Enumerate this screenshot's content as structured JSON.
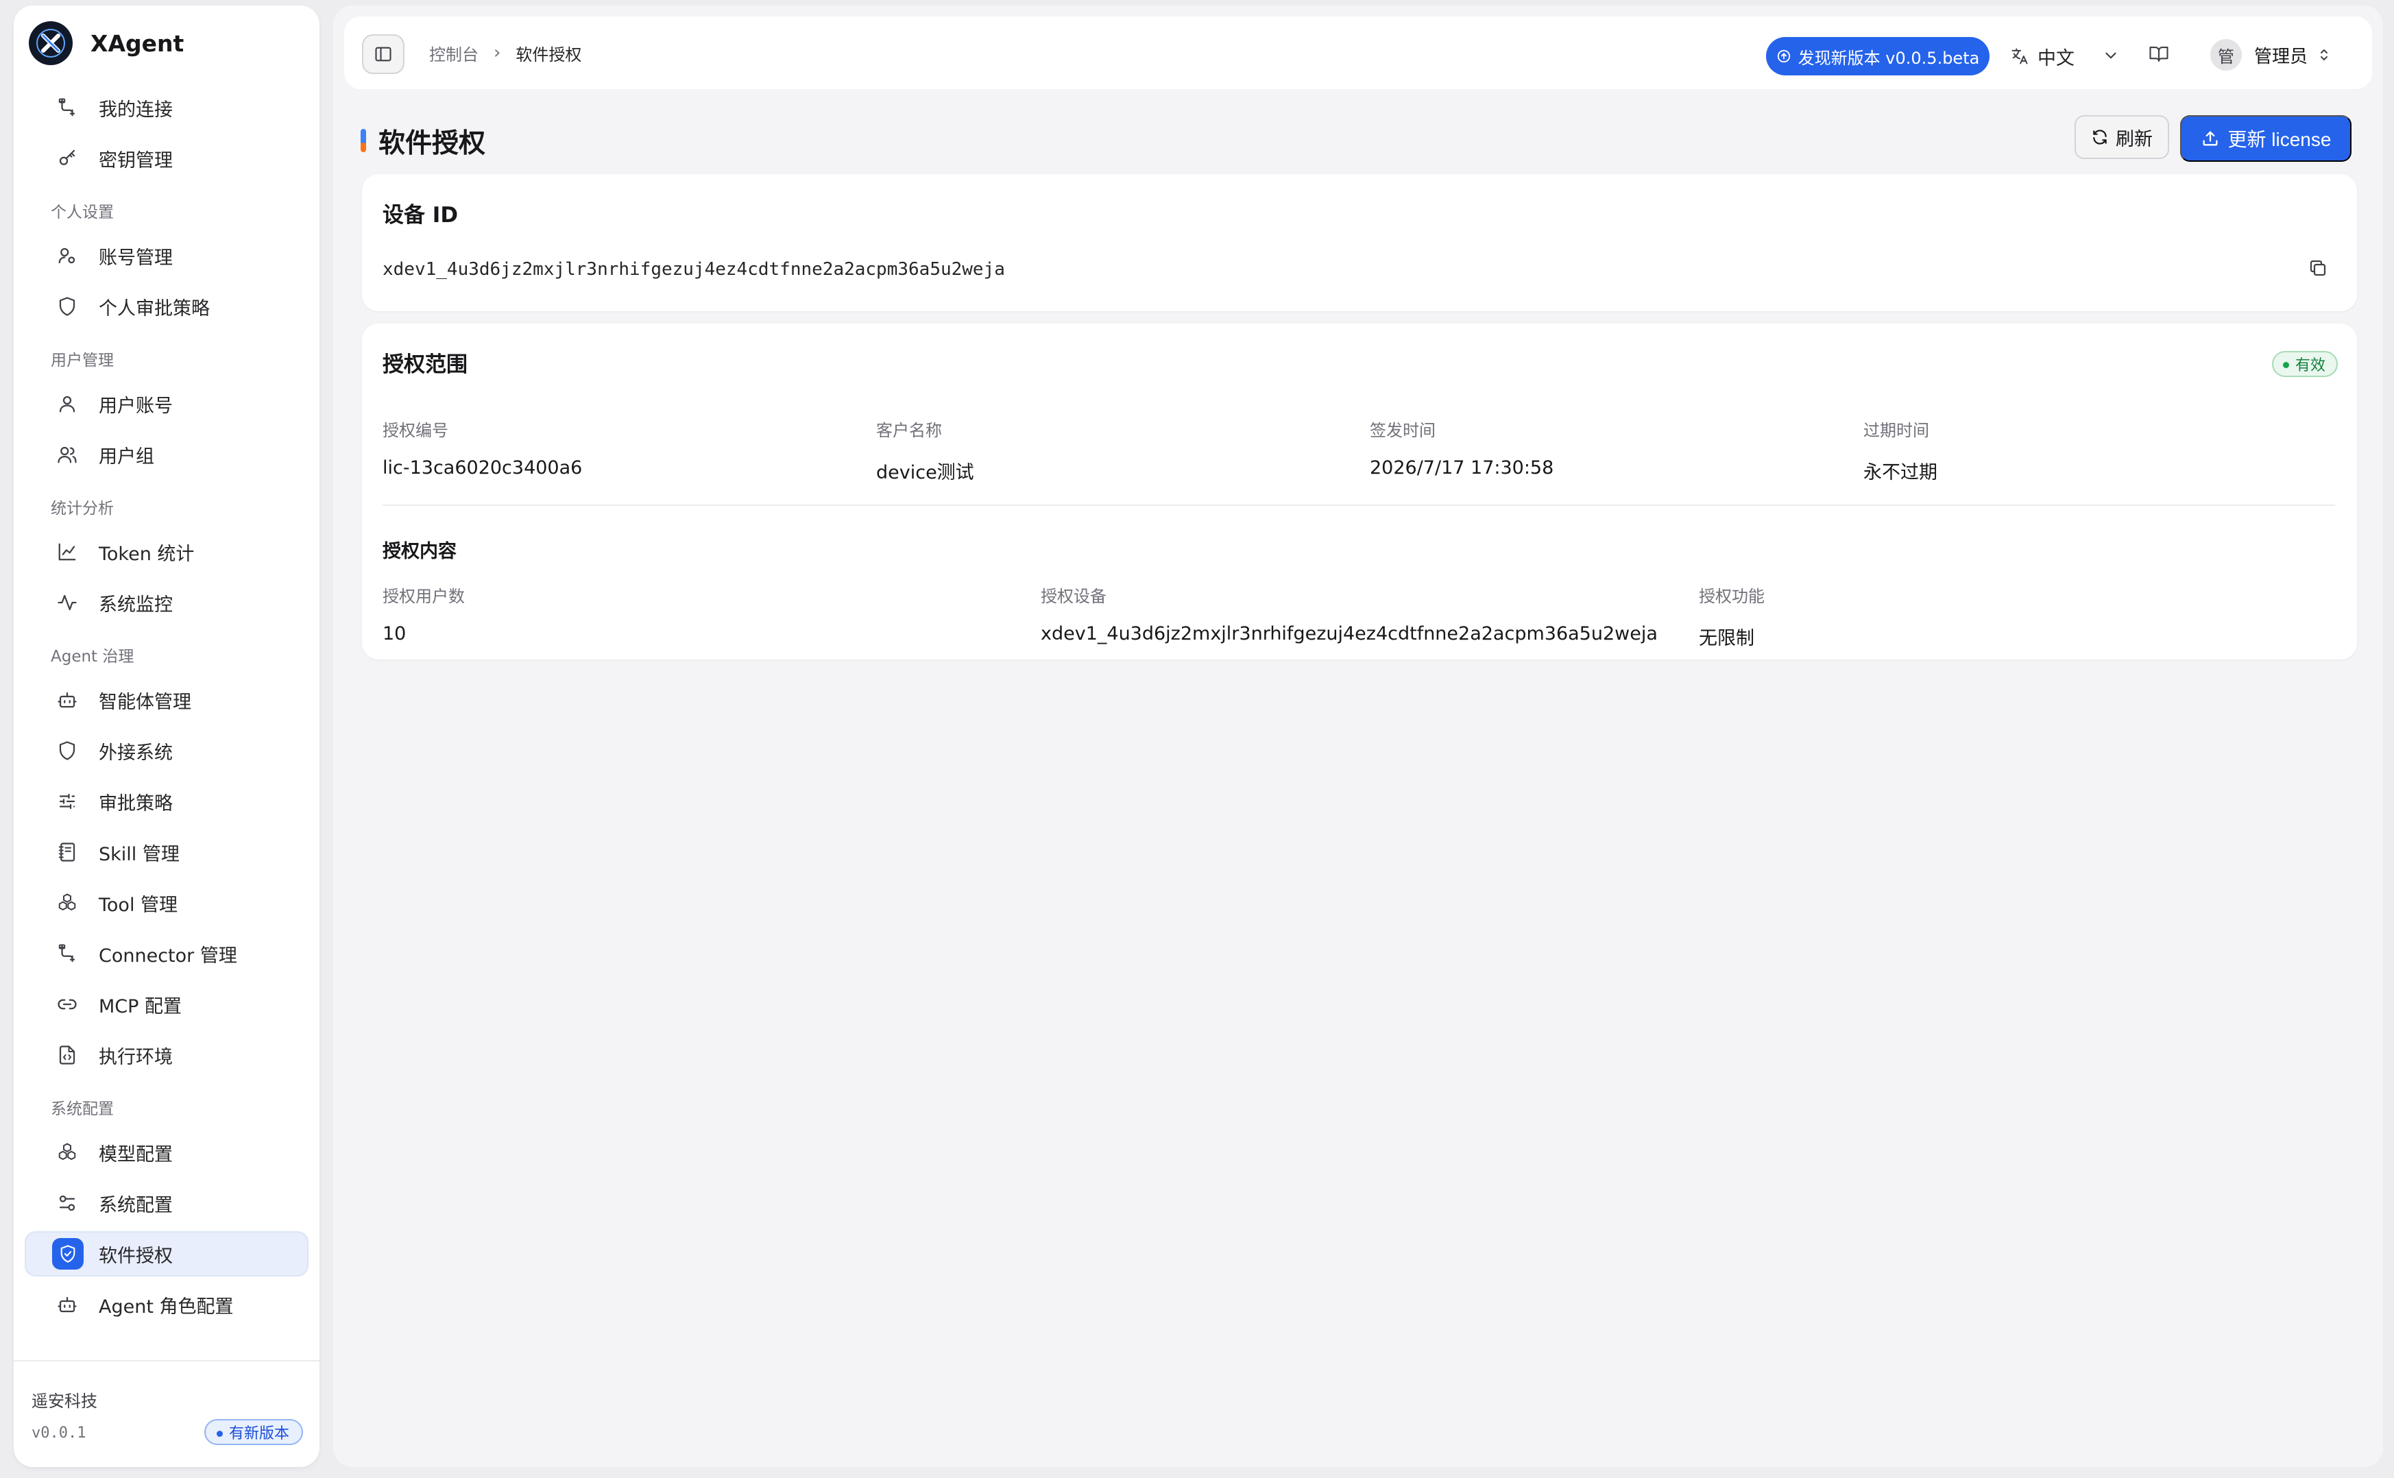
{
  "app": {
    "name": "XAgent"
  },
  "sidebar": {
    "top_items": [
      {
        "label": "我的连接",
        "icon": "connection-icon"
      },
      {
        "label": "密钥管理",
        "icon": "key-icon"
      }
    ],
    "groups": [
      {
        "title": "个人设置",
        "items": [
          {
            "label": "账号管理",
            "icon": "user-settings-icon"
          },
          {
            "label": "个人审批策略",
            "icon": "shield-icon"
          }
        ]
      },
      {
        "title": "用户管理",
        "items": [
          {
            "label": "用户账号",
            "icon": "user-icon"
          },
          {
            "label": "用户组",
            "icon": "users-icon"
          }
        ]
      },
      {
        "title": "统计分析",
        "items": [
          {
            "label": "Token 统计",
            "icon": "chart-line-icon"
          },
          {
            "label": "系统监控",
            "icon": "activity-icon"
          }
        ]
      },
      {
        "title": "Agent 治理",
        "items": [
          {
            "label": "智能体管理",
            "icon": "bot-icon"
          },
          {
            "label": "外接系统",
            "icon": "shield-icon"
          },
          {
            "label": "审批策略",
            "icon": "sliders-icon"
          },
          {
            "label": "Skill 管理",
            "icon": "notebook-icon"
          },
          {
            "label": "Tool 管理",
            "icon": "boxes-icon"
          },
          {
            "label": "Connector 管理",
            "icon": "connection-icon"
          },
          {
            "label": "MCP 配置",
            "icon": "link-icon"
          },
          {
            "label": "执行环境",
            "icon": "file-code-icon"
          }
        ]
      },
      {
        "title": "系统配置",
        "items": [
          {
            "label": "模型配置",
            "icon": "boxes-icon"
          },
          {
            "label": "系统配置",
            "icon": "settings-sliders-icon"
          },
          {
            "label": "软件授权",
            "icon": "shield-check-icon",
            "active": true
          },
          {
            "label": "Agent 角色配置",
            "icon": "bot-icon"
          }
        ]
      }
    ],
    "footer": {
      "org": "遥安科技",
      "version": "v0.0.1",
      "new_version_badge": "有新版本"
    }
  },
  "topbar": {
    "breadcrumb": [
      "控制台",
      "软件授权"
    ],
    "update_pill": "发现新版本 v0.0.5.beta",
    "language": "中文",
    "user": {
      "avatar_text": "管",
      "name": "管理员"
    }
  },
  "page": {
    "title": "软件授权",
    "refresh_label": "刷新",
    "update_license_label": "更新 license"
  },
  "device": {
    "title": "设备 ID",
    "id": "xdev1_4u3d6jz2mxjlr3nrhifgezuj4ez4cdtfnne2a2acpm36a5u2weja"
  },
  "scope": {
    "title": "授权范围",
    "status": "有效",
    "fields": [
      {
        "label": "授权编号",
        "value": "lic-13ca6020c3400a6"
      },
      {
        "label": "客户名称",
        "value": "device测试"
      },
      {
        "label": "签发时间",
        "value": "2026/7/17 17:30:58"
      },
      {
        "label": "过期时间",
        "value": "永不过期"
      }
    ],
    "content_title": "授权内容",
    "content_fields": [
      {
        "label": "授权用户数",
        "value": "10"
      },
      {
        "label": "授权设备",
        "value": "xdev1_4u3d6jz2mxjlr3nrhifgezuj4ez4cdtfnne2a2acpm36a5u2weja"
      },
      {
        "label": "授权功能",
        "value": "无限制"
      }
    ]
  },
  "colors": {
    "accent": "#2563eb",
    "success": "#16a34a",
    "background": "#f4f4f6"
  }
}
